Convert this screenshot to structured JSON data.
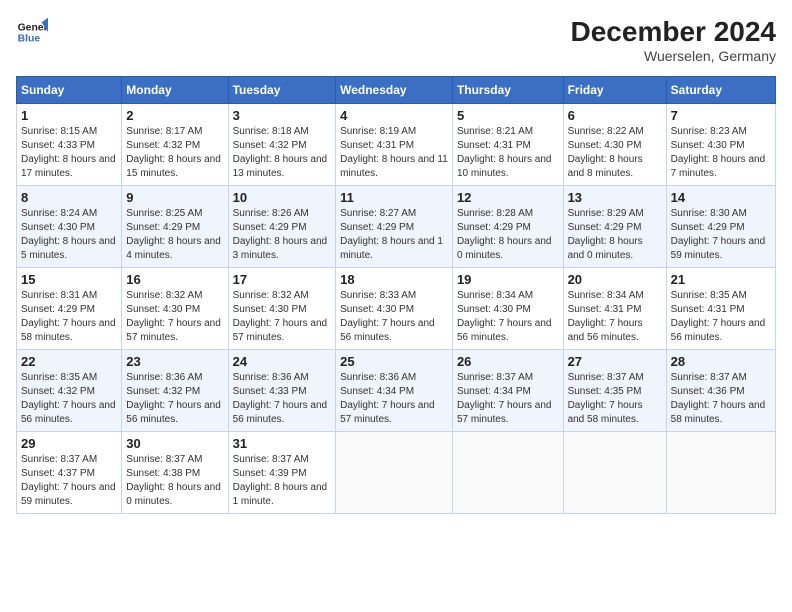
{
  "header": {
    "title": "December 2024",
    "subtitle": "Wuerselen, Germany",
    "logo_line1": "General",
    "logo_line2": "Blue"
  },
  "days_of_week": [
    "Sunday",
    "Monday",
    "Tuesday",
    "Wednesday",
    "Thursday",
    "Friday",
    "Saturday"
  ],
  "weeks": [
    [
      {
        "day": 1,
        "sunrise": "8:15 AM",
        "sunset": "4:33 PM",
        "daylight": "8 hours and 17 minutes."
      },
      {
        "day": 2,
        "sunrise": "8:17 AM",
        "sunset": "4:32 PM",
        "daylight": "8 hours and 15 minutes."
      },
      {
        "day": 3,
        "sunrise": "8:18 AM",
        "sunset": "4:32 PM",
        "daylight": "8 hours and 13 minutes."
      },
      {
        "day": 4,
        "sunrise": "8:19 AM",
        "sunset": "4:31 PM",
        "daylight": "8 hours and 11 minutes."
      },
      {
        "day": 5,
        "sunrise": "8:21 AM",
        "sunset": "4:31 PM",
        "daylight": "8 hours and 10 minutes."
      },
      {
        "day": 6,
        "sunrise": "8:22 AM",
        "sunset": "4:30 PM",
        "daylight": "8 hours and 8 minutes."
      },
      {
        "day": 7,
        "sunrise": "8:23 AM",
        "sunset": "4:30 PM",
        "daylight": "8 hours and 7 minutes."
      }
    ],
    [
      {
        "day": 8,
        "sunrise": "8:24 AM",
        "sunset": "4:30 PM",
        "daylight": "8 hours and 5 minutes."
      },
      {
        "day": 9,
        "sunrise": "8:25 AM",
        "sunset": "4:29 PM",
        "daylight": "8 hours and 4 minutes."
      },
      {
        "day": 10,
        "sunrise": "8:26 AM",
        "sunset": "4:29 PM",
        "daylight": "8 hours and 3 minutes."
      },
      {
        "day": 11,
        "sunrise": "8:27 AM",
        "sunset": "4:29 PM",
        "daylight": "8 hours and 1 minute."
      },
      {
        "day": 12,
        "sunrise": "8:28 AM",
        "sunset": "4:29 PM",
        "daylight": "8 hours and 0 minutes."
      },
      {
        "day": 13,
        "sunrise": "8:29 AM",
        "sunset": "4:29 PM",
        "daylight": "8 hours and 0 minutes."
      },
      {
        "day": 14,
        "sunrise": "8:30 AM",
        "sunset": "4:29 PM",
        "daylight": "7 hours and 59 minutes."
      }
    ],
    [
      {
        "day": 15,
        "sunrise": "8:31 AM",
        "sunset": "4:29 PM",
        "daylight": "7 hours and 58 minutes."
      },
      {
        "day": 16,
        "sunrise": "8:32 AM",
        "sunset": "4:30 PM",
        "daylight": "7 hours and 57 minutes."
      },
      {
        "day": 17,
        "sunrise": "8:32 AM",
        "sunset": "4:30 PM",
        "daylight": "7 hours and 57 minutes."
      },
      {
        "day": 18,
        "sunrise": "8:33 AM",
        "sunset": "4:30 PM",
        "daylight": "7 hours and 56 minutes."
      },
      {
        "day": 19,
        "sunrise": "8:34 AM",
        "sunset": "4:30 PM",
        "daylight": "7 hours and 56 minutes."
      },
      {
        "day": 20,
        "sunrise": "8:34 AM",
        "sunset": "4:31 PM",
        "daylight": "7 hours and 56 minutes."
      },
      {
        "day": 21,
        "sunrise": "8:35 AM",
        "sunset": "4:31 PM",
        "daylight": "7 hours and 56 minutes."
      }
    ],
    [
      {
        "day": 22,
        "sunrise": "8:35 AM",
        "sunset": "4:32 PM",
        "daylight": "7 hours and 56 minutes."
      },
      {
        "day": 23,
        "sunrise": "8:36 AM",
        "sunset": "4:32 PM",
        "daylight": "7 hours and 56 minutes."
      },
      {
        "day": 24,
        "sunrise": "8:36 AM",
        "sunset": "4:33 PM",
        "daylight": "7 hours and 56 minutes."
      },
      {
        "day": 25,
        "sunrise": "8:36 AM",
        "sunset": "4:34 PM",
        "daylight": "7 hours and 57 minutes."
      },
      {
        "day": 26,
        "sunrise": "8:37 AM",
        "sunset": "4:34 PM",
        "daylight": "7 hours and 57 minutes."
      },
      {
        "day": 27,
        "sunrise": "8:37 AM",
        "sunset": "4:35 PM",
        "daylight": "7 hours and 58 minutes."
      },
      {
        "day": 28,
        "sunrise": "8:37 AM",
        "sunset": "4:36 PM",
        "daylight": "7 hours and 58 minutes."
      }
    ],
    [
      {
        "day": 29,
        "sunrise": "8:37 AM",
        "sunset": "4:37 PM",
        "daylight": "7 hours and 59 minutes."
      },
      {
        "day": 30,
        "sunrise": "8:37 AM",
        "sunset": "4:38 PM",
        "daylight": "8 hours and 0 minutes."
      },
      {
        "day": 31,
        "sunrise": "8:37 AM",
        "sunset": "4:39 PM",
        "daylight": "8 hours and 1 minute."
      },
      null,
      null,
      null,
      null
    ]
  ]
}
